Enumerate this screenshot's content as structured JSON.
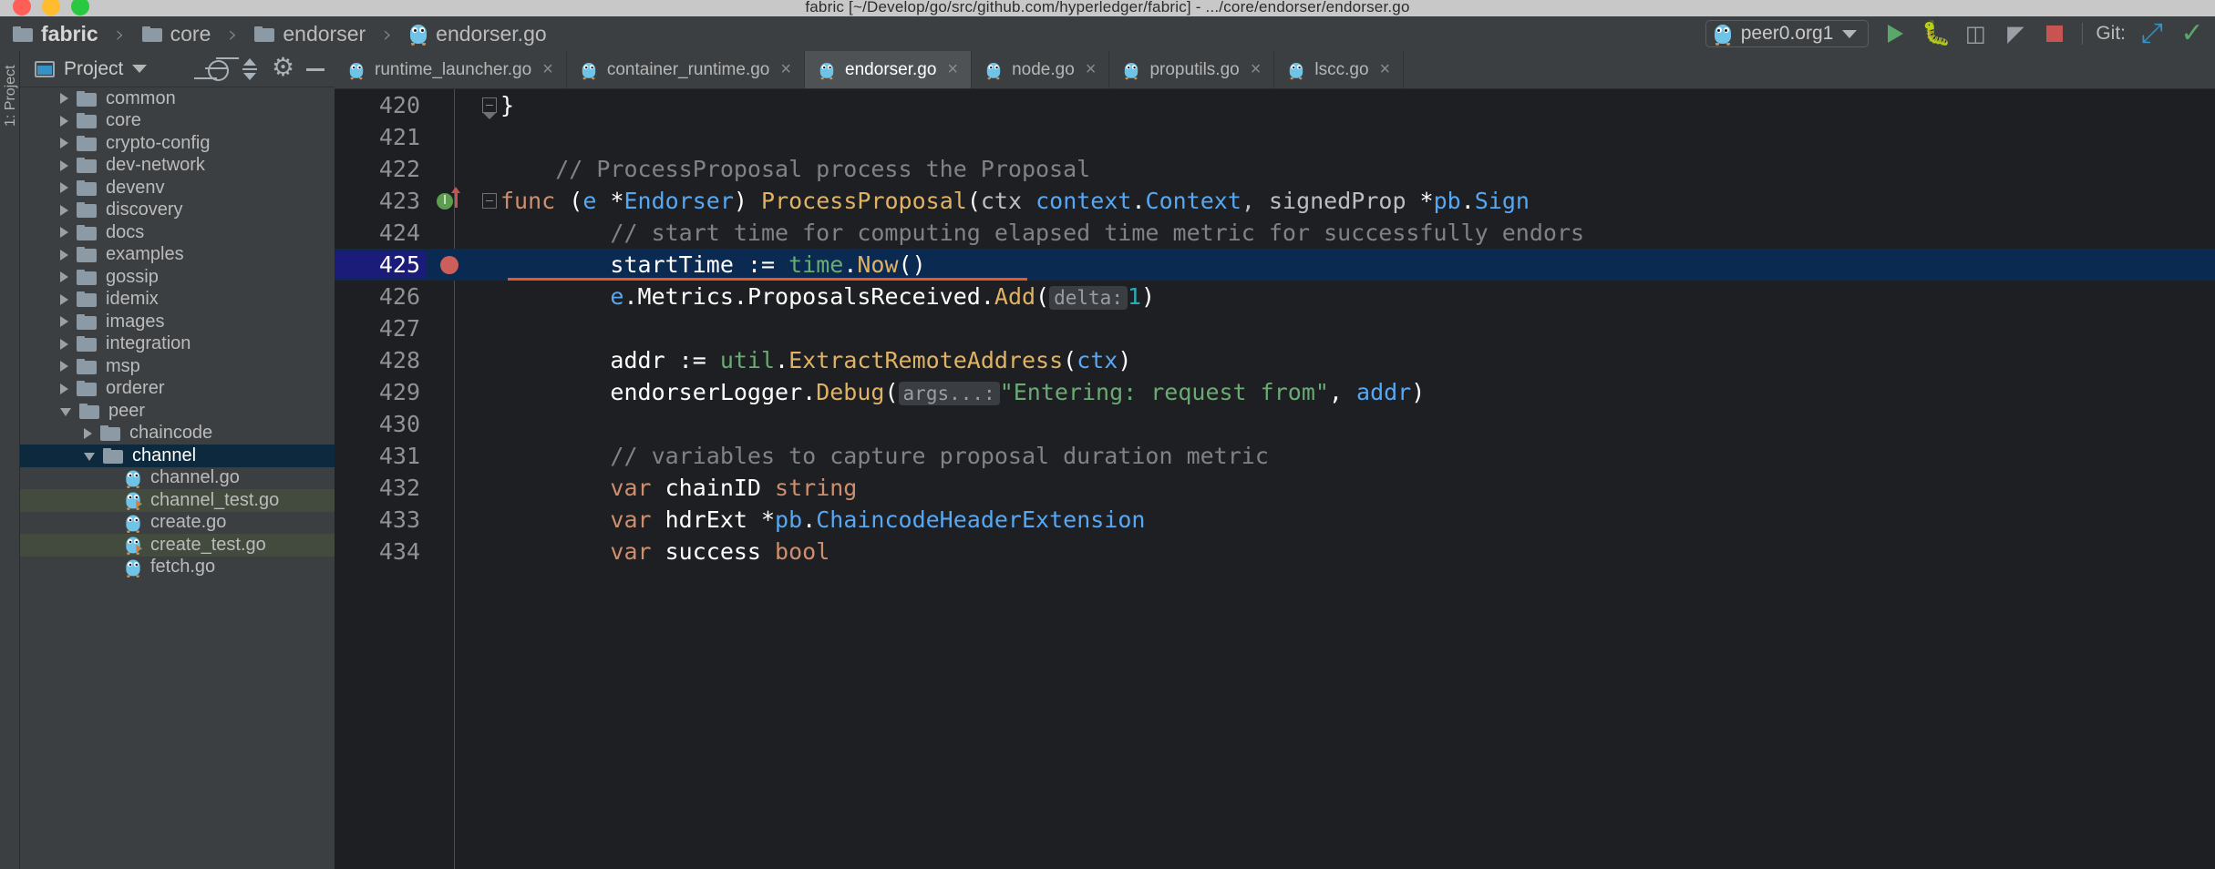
{
  "window": {
    "mac_title": "fabric [~/Develop/go/src/github.com/hyperledger/fabric] - .../core/endorser/endorser.go",
    "traffic": [
      "close",
      "minimize",
      "zoom"
    ]
  },
  "breadcrumb": {
    "items": [
      {
        "label": "fabric",
        "icon": "folder-icon",
        "bold": true
      },
      {
        "label": "core",
        "icon": "folder-icon",
        "bold": false
      },
      {
        "label": "endorser",
        "icon": "folder-icon",
        "bold": false
      },
      {
        "label": "endorser.go",
        "icon": "go-file-icon",
        "bold": false
      }
    ],
    "separator": "›"
  },
  "toolbar": {
    "run_config": "peer0.org1",
    "buttons": [
      {
        "name": "run-button",
        "icon": "play-icon"
      },
      {
        "name": "debug-button",
        "icon": "bug-icon"
      },
      {
        "name": "run-with-coverage-button",
        "icon": "coverage-icon"
      },
      {
        "name": "profile-button",
        "icon": "profiler-icon"
      },
      {
        "name": "stop-button",
        "icon": "stop-icon"
      }
    ],
    "git_label": "Git:",
    "git_buttons": [
      {
        "name": "update-project-button",
        "icon": "arrow-down-left-icon"
      },
      {
        "name": "commit-button",
        "icon": "checkmark-icon"
      }
    ]
  },
  "left_strip": {
    "label": "1: Project"
  },
  "project_panel": {
    "title": "Project",
    "header_icons": [
      {
        "name": "scroll-from-source-icon"
      },
      {
        "name": "collapse-all-icon"
      },
      {
        "name": "settings-gear-icon"
      },
      {
        "name": "hide-panel-icon"
      }
    ],
    "tree": [
      {
        "label": "common",
        "type": "folder",
        "indent": 1,
        "state": "collapsed",
        "highlight": "none"
      },
      {
        "label": "core",
        "type": "folder",
        "indent": 1,
        "state": "collapsed",
        "highlight": "none"
      },
      {
        "label": "crypto-config",
        "type": "folder",
        "indent": 1,
        "state": "collapsed",
        "highlight": "none"
      },
      {
        "label": "dev-network",
        "type": "folder",
        "indent": 1,
        "state": "collapsed",
        "highlight": "none"
      },
      {
        "label": "devenv",
        "type": "folder",
        "indent": 1,
        "state": "collapsed",
        "highlight": "none"
      },
      {
        "label": "discovery",
        "type": "folder",
        "indent": 1,
        "state": "collapsed",
        "highlight": "none"
      },
      {
        "label": "docs",
        "type": "folder",
        "indent": 1,
        "state": "collapsed",
        "highlight": "none"
      },
      {
        "label": "examples",
        "type": "folder",
        "indent": 1,
        "state": "collapsed",
        "highlight": "none"
      },
      {
        "label": "gossip",
        "type": "folder",
        "indent": 1,
        "state": "collapsed",
        "highlight": "none"
      },
      {
        "label": "idemix",
        "type": "folder",
        "indent": 1,
        "state": "collapsed",
        "highlight": "none"
      },
      {
        "label": "images",
        "type": "folder",
        "indent": 1,
        "state": "collapsed",
        "highlight": "none"
      },
      {
        "label": "integration",
        "type": "folder",
        "indent": 1,
        "state": "collapsed",
        "highlight": "none"
      },
      {
        "label": "msp",
        "type": "folder",
        "indent": 1,
        "state": "collapsed",
        "highlight": "none"
      },
      {
        "label": "orderer",
        "type": "folder",
        "indent": 1,
        "state": "collapsed",
        "highlight": "none"
      },
      {
        "label": "peer",
        "type": "folder",
        "indent": 1,
        "state": "expanded",
        "highlight": "none"
      },
      {
        "label": "chaincode",
        "type": "folder",
        "indent": 2,
        "state": "collapsed",
        "highlight": "none"
      },
      {
        "label": "channel",
        "type": "folder",
        "indent": 2,
        "state": "expanded",
        "highlight": "selected"
      },
      {
        "label": "channel.go",
        "type": "gofile",
        "indent": 3,
        "state": "leaf",
        "highlight": "none"
      },
      {
        "label": "channel_test.go",
        "type": "gotestfile",
        "indent": 3,
        "state": "leaf",
        "highlight": "test"
      },
      {
        "label": "create.go",
        "type": "gofile",
        "indent": 3,
        "state": "leaf",
        "highlight": "none"
      },
      {
        "label": "create_test.go",
        "type": "gotestfile",
        "indent": 3,
        "state": "leaf",
        "highlight": "test"
      },
      {
        "label": "fetch.go",
        "type": "gofile",
        "indent": 3,
        "state": "leaf",
        "highlight": "none"
      }
    ]
  },
  "tabs": [
    {
      "label": "runtime_launcher.go",
      "icon": "go-file-icon",
      "active": false,
      "close": "×"
    },
    {
      "label": "container_runtime.go",
      "icon": "go-file-icon",
      "active": false,
      "close": "×"
    },
    {
      "label": "endorser.go",
      "icon": "go-file-icon",
      "active": true,
      "close": "×"
    },
    {
      "label": "node.go",
      "icon": "go-file-icon",
      "active": false,
      "close": "×"
    },
    {
      "label": "proputils.go",
      "icon": "go-file-icon",
      "active": false,
      "close": "×"
    },
    {
      "label": "lscc.go",
      "icon": "go-file-icon",
      "active": false,
      "close": "×"
    }
  ],
  "editor": {
    "file": "endorser.go",
    "current_line": 425,
    "breakpoint_line": 425,
    "lines": [
      {
        "num": "420",
        "gutter": "none",
        "fold": "tip",
        "current": false,
        "tokens": [
          {
            "t": "}",
            "c": "c-white"
          }
        ]
      },
      {
        "num": "421",
        "gutter": "none",
        "fold": "none",
        "current": false,
        "tokens": []
      },
      {
        "num": "422",
        "gutter": "none",
        "fold": "none",
        "current": false,
        "tokens": [
          {
            "t": "    // ProcessProposal process the Proposal",
            "c": "c-comment"
          }
        ]
      },
      {
        "num": "423",
        "gutter": "implements",
        "fold": "open",
        "current": false,
        "tokens": [
          {
            "t": "func ",
            "c": "c-kw"
          },
          {
            "t": "(",
            "c": "c-white"
          },
          {
            "t": "e ",
            "c": "c-type"
          },
          {
            "t": "*",
            "c": "c-white"
          },
          {
            "t": "Endorser",
            "c": "c-type"
          },
          {
            "t": ") ",
            "c": "c-white"
          },
          {
            "t": "ProcessProposal",
            "c": "c-fn"
          },
          {
            "t": "(",
            "c": "c-white"
          },
          {
            "t": "ctx ",
            "c": "c-ident"
          },
          {
            "t": "context",
            "c": "c-type"
          },
          {
            "t": ".",
            "c": "c-white"
          },
          {
            "t": "Context",
            "c": "c-type"
          },
          {
            "t": ", signedProp ",
            "c": "c-ident"
          },
          {
            "t": "*",
            "c": "c-white"
          },
          {
            "t": "pb",
            "c": "c-type"
          },
          {
            "t": ".",
            "c": "c-white"
          },
          {
            "t": "Sign",
            "c": "c-type"
          }
        ]
      },
      {
        "num": "424",
        "gutter": "none",
        "fold": "none",
        "current": false,
        "tokens": [
          {
            "t": "        // start time for computing elapsed time metric for successfully endors",
            "c": "c-comment"
          }
        ]
      },
      {
        "num": "425",
        "gutter": "breakpoint",
        "fold": "none",
        "current": true,
        "tokens": [
          {
            "t": "        startTime ",
            "c": "c-white"
          },
          {
            "t": ":= ",
            "c": "c-white"
          },
          {
            "t": "time",
            "c": "c-str"
          },
          {
            "t": ".",
            "c": "c-white"
          },
          {
            "t": "Now",
            "c": "c-fn"
          },
          {
            "t": "()",
            "c": "c-white"
          }
        ]
      },
      {
        "num": "426",
        "gutter": "none",
        "fold": "none",
        "current": false,
        "tokens": [
          {
            "t": "        e",
            "c": "c-field"
          },
          {
            "t": ".",
            "c": "c-white"
          },
          {
            "t": "Metrics",
            "c": "c-white"
          },
          {
            "t": ".",
            "c": "c-white"
          },
          {
            "t": "ProposalsReceived",
            "c": "c-white"
          },
          {
            "t": ".",
            "c": "c-white"
          },
          {
            "t": "Add",
            "c": "c-fn"
          },
          {
            "t": "(",
            "c": "c-white"
          },
          {
            "t": "delta:",
            "c": "hint"
          },
          {
            "t": "1",
            "c": "c-num"
          },
          {
            "t": ")",
            "c": "c-white"
          }
        ]
      },
      {
        "num": "427",
        "gutter": "none",
        "fold": "none",
        "current": false,
        "tokens": []
      },
      {
        "num": "428",
        "gutter": "none",
        "fold": "none",
        "current": false,
        "tokens": [
          {
            "t": "        addr ",
            "c": "c-white"
          },
          {
            "t": ":= ",
            "c": "c-white"
          },
          {
            "t": "util",
            "c": "c-str"
          },
          {
            "t": ".",
            "c": "c-white"
          },
          {
            "t": "ExtractRemoteAddress",
            "c": "c-fn"
          },
          {
            "t": "(",
            "c": "c-white"
          },
          {
            "t": "ctx",
            "c": "c-field"
          },
          {
            "t": ")",
            "c": "c-white"
          }
        ]
      },
      {
        "num": "429",
        "gutter": "none",
        "fold": "none",
        "current": false,
        "tokens": [
          {
            "t": "        endorserLogger",
            "c": "c-white"
          },
          {
            "t": ".",
            "c": "c-white"
          },
          {
            "t": "Debug",
            "c": "c-fn"
          },
          {
            "t": "(",
            "c": "c-white"
          },
          {
            "t": "args...:",
            "c": "hint"
          },
          {
            "t": "\"Entering: request from\"",
            "c": "c-str"
          },
          {
            "t": ", ",
            "c": "c-white"
          },
          {
            "t": "addr",
            "c": "c-field"
          },
          {
            "t": ")",
            "c": "c-white"
          }
        ]
      },
      {
        "num": "430",
        "gutter": "none",
        "fold": "none",
        "current": false,
        "tokens": []
      },
      {
        "num": "431",
        "gutter": "none",
        "fold": "none",
        "current": false,
        "tokens": [
          {
            "t": "        // variables to capture proposal duration metric",
            "c": "c-comment"
          }
        ]
      },
      {
        "num": "432",
        "gutter": "none",
        "fold": "none",
        "current": false,
        "tokens": [
          {
            "t": "        var ",
            "c": "c-kw"
          },
          {
            "t": "chainID ",
            "c": "c-white"
          },
          {
            "t": "string",
            "c": "c-kw"
          }
        ]
      },
      {
        "num": "433",
        "gutter": "none",
        "fold": "none",
        "current": false,
        "tokens": [
          {
            "t": "        var ",
            "c": "c-kw"
          },
          {
            "t": "hdrExt ",
            "c": "c-white"
          },
          {
            "t": "*",
            "c": "c-white"
          },
          {
            "t": "pb",
            "c": "c-type"
          },
          {
            "t": ".",
            "c": "c-white"
          },
          {
            "t": "ChaincodeHeaderExtension",
            "c": "c-type"
          }
        ]
      },
      {
        "num": "434",
        "gutter": "none",
        "fold": "none",
        "current": false,
        "tokens": [
          {
            "t": "        var ",
            "c": "c-kw"
          },
          {
            "t": "success ",
            "c": "c-white"
          },
          {
            "t": "bool",
            "c": "c-kw"
          }
        ]
      }
    ]
  },
  "colors": {
    "accent_blue": "#0a2a52",
    "breakpoint_red": "#cc5f5a",
    "error_underline": "#e8562a",
    "test_highlight": "#434b3e",
    "selection": "#0d293e",
    "gopher_blue": "#6ec3e6",
    "run_green": "#59a869"
  }
}
